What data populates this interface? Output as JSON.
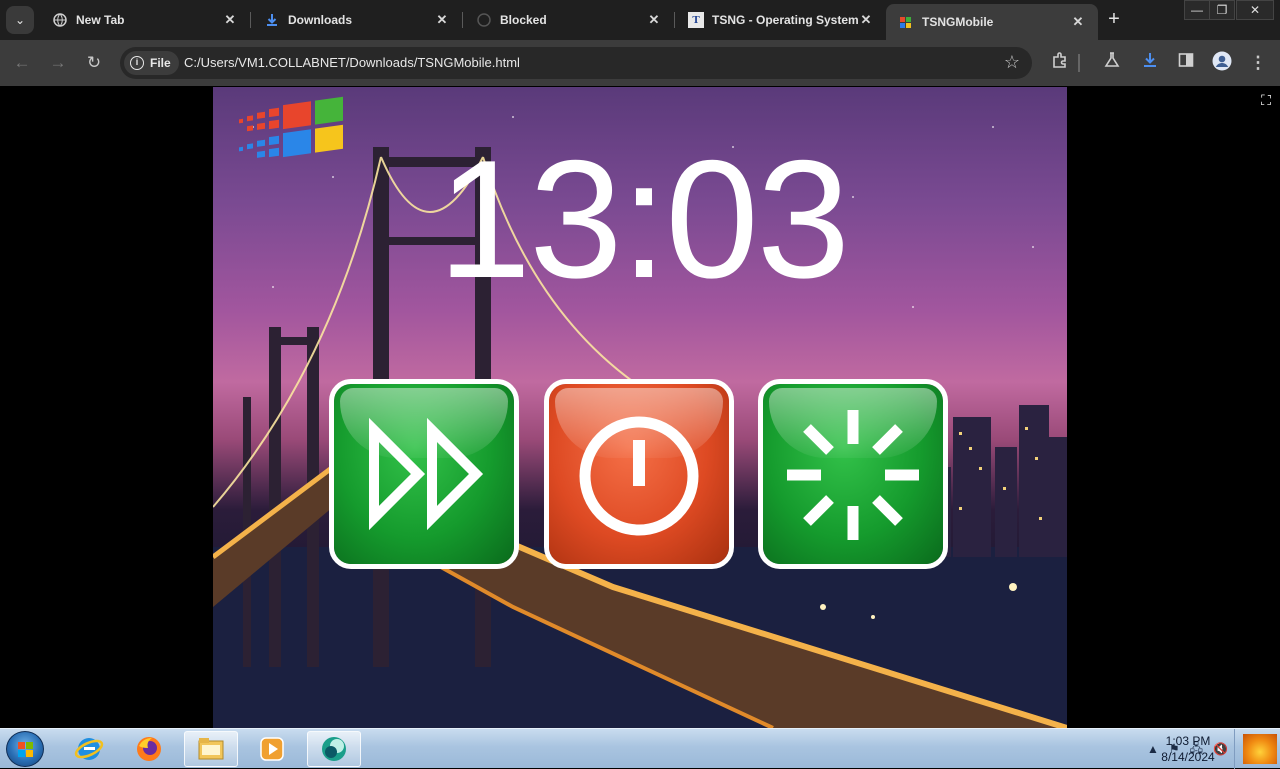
{
  "browser": {
    "tabs": [
      {
        "title": "New Tab",
        "icon": "globe-icon",
        "active": false
      },
      {
        "title": "Downloads",
        "icon": "download-icon",
        "active": false
      },
      {
        "title": "Blocked",
        "icon": "blocked-icon",
        "active": false
      },
      {
        "title": "TSNG - Operating System",
        "icon": "tsng-t-icon",
        "active": false
      },
      {
        "title": "TSNGMobile",
        "icon": "tsng-mobile-icon",
        "active": true
      }
    ],
    "address": {
      "scheme_chip": "File",
      "url": "C:/Users/VM1.COLLABNET/Downloads/TSNGMobile.html"
    }
  },
  "page": {
    "clock": "13:03",
    "buttons": [
      {
        "name": "fast-forward",
        "icon": "fast-forward-icon",
        "color": "#159b2d"
      },
      {
        "name": "power",
        "icon": "power-icon",
        "color": "#de4a23"
      },
      {
        "name": "loading",
        "icon": "loading-spinner-icon",
        "color": "#159b2d"
      }
    ]
  },
  "taskbar": {
    "apps": [
      "internet-explorer-icon",
      "firefox-icon",
      "file-explorer-icon",
      "media-player-icon",
      "tsng-app-icon"
    ],
    "time": "1:03 PM",
    "date": "8/14/2024"
  },
  "colors": {
    "tab_bg": "#1f1f1f",
    "toolbar_bg": "#3c3c3c",
    "accent_green": "#159b2d",
    "accent_red": "#de4a23"
  }
}
